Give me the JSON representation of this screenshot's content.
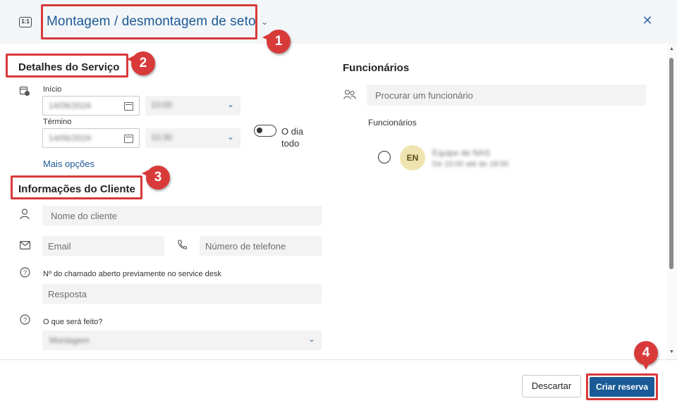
{
  "header": {
    "service_icon_text": "1:1",
    "title": "Montagem / desmontagem de setor",
    "close_icon": "close-icon"
  },
  "annotations": [
    "1",
    "2",
    "3",
    "4"
  ],
  "service_details": {
    "heading": "Detalhes do Serviço",
    "start_label": "Início",
    "start_date": "14/06/2024",
    "start_time": "10:00",
    "end_label": "Término",
    "end_date": "14/06/2024",
    "end_time": "10:30",
    "all_day_label_1": "O dia",
    "all_day_label_2": "todo",
    "more_options": "Mais opções"
  },
  "client_info": {
    "heading": "Informações do Cliente",
    "name_placeholder": "Nome do cliente",
    "email_placeholder": "Email",
    "phone_placeholder": "Número de telefone",
    "ticket_question": "Nº do chamado aberto previamente no service desk",
    "ticket_placeholder": "Resposta",
    "task_question": "O que será feito?",
    "task_value": "Montagem"
  },
  "employees": {
    "heading": "Funcionários",
    "search_placeholder": "Procurar um funcionário",
    "list_heading": "Funcionários",
    "items": [
      {
        "initials": "EN",
        "name": "Equipe de NAS",
        "detail": "De 10:00 até às 18:00"
      }
    ]
  },
  "footer": {
    "discard_label": "Descartar",
    "create_label": "Criar reserva"
  },
  "colors": {
    "accent": "#1a5b97",
    "annotation_red": "#d83a3a",
    "header_bg": "#f3f6f9"
  }
}
